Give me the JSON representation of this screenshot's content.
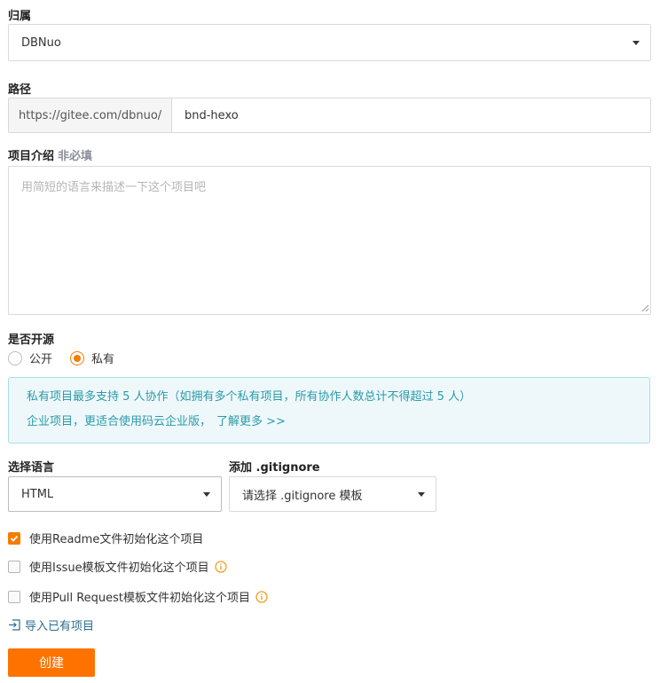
{
  "owner": {
    "label": "归属",
    "value": "DBNuo"
  },
  "path": {
    "label": "路径",
    "prefix": "https://gitee.com/dbnuo/",
    "value": "bnd-hexo"
  },
  "description": {
    "label": "项目介绍",
    "optional_tag": "非必填",
    "placeholder": "用简短的语言来描述一下这个项目吧",
    "value": ""
  },
  "visibility": {
    "label": "是否开源",
    "options": [
      {
        "label": "公开",
        "checked": false
      },
      {
        "label": "私有",
        "checked": true
      }
    ]
  },
  "notice": {
    "line1": "私有项目最多支持 5 人协作（如拥有多个私有项目，所有协作人数总计不得超过 5 人）",
    "line2": "企业项目，更适合使用码云企业版，",
    "link": "了解更多 >>"
  },
  "language": {
    "label": "选择语言",
    "value": "HTML"
  },
  "gitignore": {
    "label": "添加 .gitignore",
    "value": "请选择 .gitignore 模板"
  },
  "init_options": [
    {
      "label": "使用Readme文件初始化这个项目",
      "checked": true,
      "info": false
    },
    {
      "label": "使用Issue模板文件初始化这个项目",
      "checked": false,
      "info": true
    },
    {
      "label": "使用Pull Request模板文件初始化这个项目",
      "checked": false,
      "info": true
    }
  ],
  "import_link": "导入已有项目",
  "create_button": "创建",
  "colors": {
    "accent": "#fe7300",
    "notice_text": "#2c9aa8",
    "notice_bg": "#eef8fb"
  }
}
